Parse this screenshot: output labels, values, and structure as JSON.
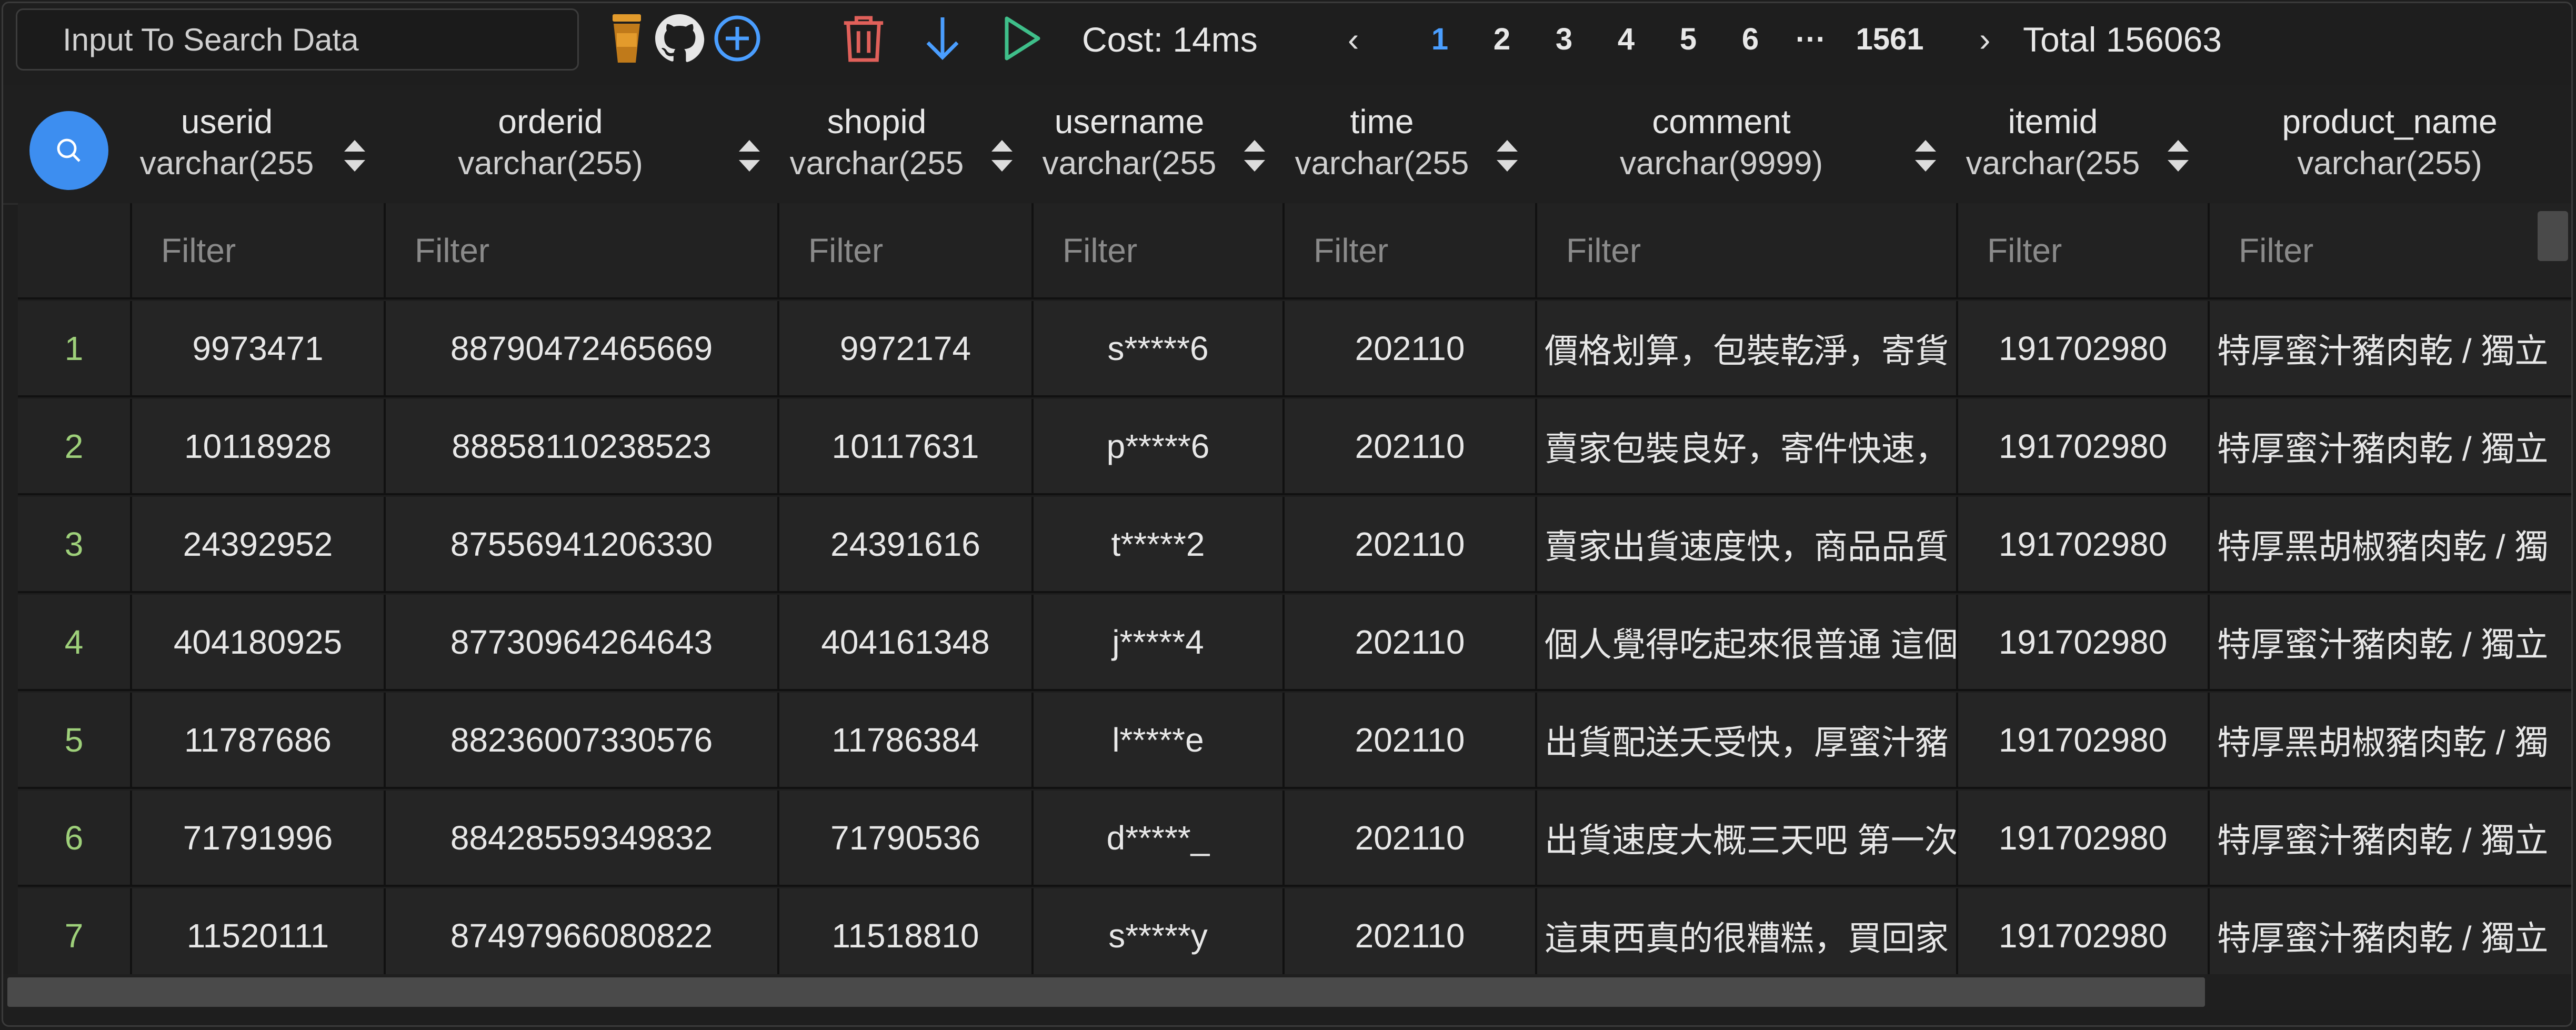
{
  "toolbar": {
    "search_placeholder": "Input To Search Data",
    "cost": "Cost: 14ms",
    "pages": [
      "1",
      "2",
      "3",
      "4",
      "5",
      "6"
    ],
    "ellipsis": "···",
    "last_page": "1561",
    "prev": "‹",
    "next": "›",
    "total": "Total 156063"
  },
  "colors": {
    "accent": "#4a9eff",
    "search_circle": "#3d8ef0",
    "row_index": "#9ed07a",
    "trash": "#e0605a",
    "play": "#3fbf8a",
    "cup": "#e39b2c"
  },
  "columns": [
    {
      "name": "userid",
      "type": "varchar(255"
    },
    {
      "name": "orderid",
      "type": "varchar(255)"
    },
    {
      "name": "shopid",
      "type": "varchar(255"
    },
    {
      "name": "username",
      "type": "varchar(255"
    },
    {
      "name": "time",
      "type": "varchar(255"
    },
    {
      "name": "comment",
      "type": "varchar(9999)"
    },
    {
      "name": "itemid",
      "type": "varchar(255"
    },
    {
      "name": "product_name",
      "type": "varchar(255)"
    }
  ],
  "filter_placeholder": "Filter",
  "rows": [
    [
      "1",
      "9973471",
      "88790472465669",
      "9972174",
      "s*****6",
      "202110",
      "價格划算，包裝乾淨，寄貨",
      "191702980",
      "特厚蜜汁豬肉乾 / 獨立"
    ],
    [
      "2",
      "10118928",
      "88858110238523",
      "10117631",
      "p*****6",
      "202110",
      "賣家包裝良好，寄件快速，",
      "191702980",
      "特厚蜜汁豬肉乾 / 獨立"
    ],
    [
      "3",
      "24392952",
      "87556941206330",
      "24391616",
      "t*****2",
      "202110",
      "賣家出貨速度快，商品品質",
      "191702980",
      "特厚黑胡椒豬肉乾 / 獨"
    ],
    [
      "4",
      "404180925",
      "87730964264643",
      "404161348",
      "j*****4",
      "202110",
      "個人覺得吃起來很普通 這個",
      "191702980",
      "特厚蜜汁豬肉乾 / 獨立"
    ],
    [
      "5",
      "11787686",
      "88236007330576",
      "11786384",
      "l*****e",
      "202110",
      "出貨配送夭受快，厚蜜汁豬",
      "191702980",
      "特厚黑胡椒豬肉乾 / 獨"
    ],
    [
      "6",
      "71791996",
      "88428559349832",
      "71790536",
      "d*****_",
      "202110",
      "出貨速度大概三天吧 第一次",
      "191702980",
      "特厚蜜汁豬肉乾 / 獨立"
    ],
    [
      "7",
      "11520111",
      "87497966080822",
      "11518810",
      "s*****y",
      "202110",
      "這東西真的很糟糕，買回家",
      "191702980",
      "特厚蜜汁豬肉乾 / 獨立"
    ]
  ]
}
